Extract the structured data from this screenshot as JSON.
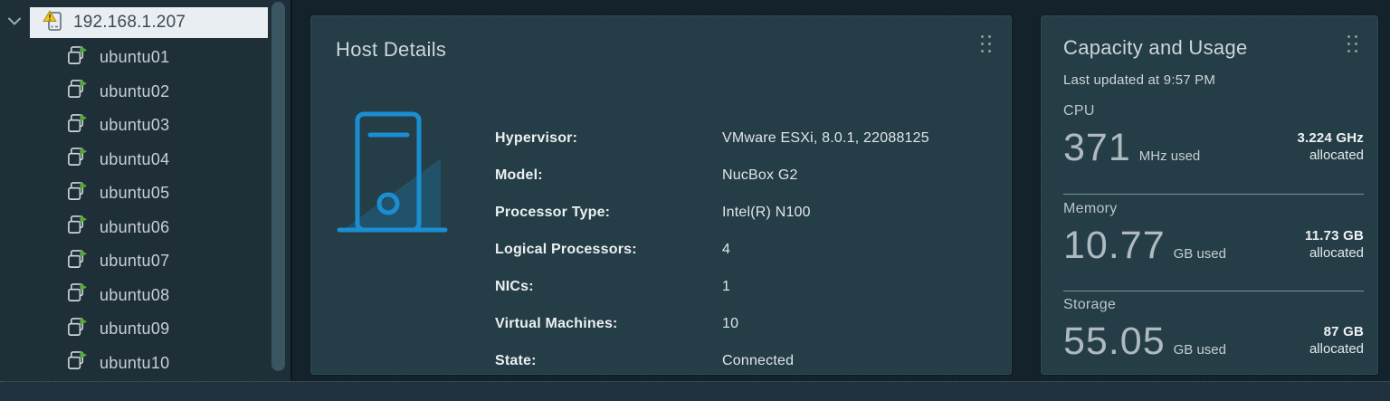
{
  "sidebar": {
    "host": {
      "label": "192.168.1.207"
    },
    "vms": [
      "ubuntu01",
      "ubuntu02",
      "ubuntu03",
      "ubuntu04",
      "ubuntu05",
      "ubuntu06",
      "ubuntu07",
      "ubuntu08",
      "ubuntu09",
      "ubuntu10"
    ]
  },
  "host_details": {
    "title": "Host Details",
    "rows": [
      {
        "label": "Hypervisor:",
        "value": "VMware ESXi, 8.0.1, 22088125"
      },
      {
        "label": "Model:",
        "value": "NucBox G2"
      },
      {
        "label": "Processor Type:",
        "value": "Intel(R) N100"
      },
      {
        "label": "Logical Processors:",
        "value": "4"
      },
      {
        "label": "NICs:",
        "value": "1"
      },
      {
        "label": "Virtual Machines:",
        "value": "10"
      },
      {
        "label": "State:",
        "value": "Connected"
      }
    ]
  },
  "capacity": {
    "title": "Capacity and Usage",
    "last_updated": "Last updated at 9:57 PM",
    "sections": [
      {
        "name": "CPU",
        "used_value": "371",
        "used_unit": "MHz used",
        "allocated_value": "3.224 GHz",
        "allocated_label": "allocated"
      },
      {
        "name": "Memory",
        "used_value": "10.77",
        "used_unit": "GB used",
        "allocated_value": "11.73 GB",
        "allocated_label": "allocated"
      },
      {
        "name": "Storage",
        "used_value": "55.05",
        "used_unit": "GB used",
        "allocated_value": "87 GB",
        "allocated_label": "allocated"
      }
    ]
  },
  "icons": {
    "tree_chevron": "chevron-down",
    "host_tree_icon": "host-with-warning-badge",
    "vm_tree_icon": "vm-with-running-play-badge",
    "card_handle": "grip-dots-2x3",
    "host_graphic": "server-tower-outline"
  },
  "colors": {
    "page_bg": "#14232b",
    "sidebar_bg": "#1e2f38",
    "card_bg": "#253d46",
    "selected_row_bg": "#e9eef2",
    "accent_blue": "#1b8ed2",
    "warning_yellow": "#f3c41e",
    "vm_running_green": "#5aa63e",
    "divider_gray": "#7d929c"
  }
}
